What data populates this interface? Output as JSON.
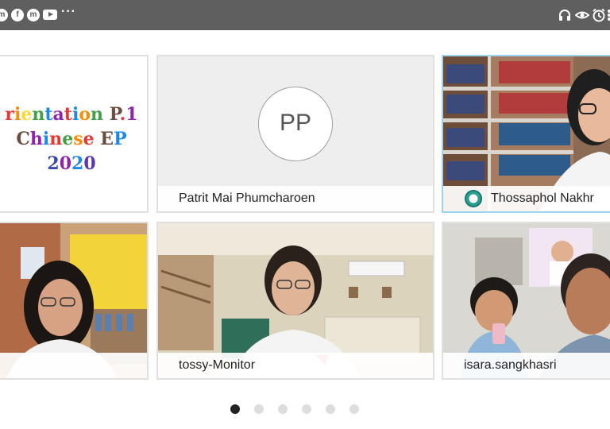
{
  "topbar": {
    "left_icons": [
      "messenger-icon",
      "facebook-icon",
      "messenger-icon",
      "youtube-icon",
      "more-icon"
    ],
    "more_label": "···",
    "right_icons": [
      "headphones-icon",
      "eye-icon",
      "alarm-icon",
      "overflow-icon"
    ]
  },
  "tiles": [
    {
      "type": "shared-content",
      "lines": [
        {
          "text": "rientation P.1",
          "colors": [
            "#e53935",
            "#fb8c00",
            "#fdd835",
            "#43a047",
            "#1e88e5",
            "#8e24aa",
            "#e53935",
            "#1e88e5",
            "#fb8c00",
            "#43a047",
            "#6d4c41",
            "#e53935",
            "#8e24aa",
            "#1e88e5"
          ]
        },
        {
          "text": "Chinese EP",
          "colors": [
            "#6d4c41",
            "#8e24aa",
            "#1e88e5",
            "#e53935",
            "#43a047",
            "#fb8c00",
            "#e53935",
            "#6d4c41",
            "#1e88e5",
            "#8e24aa"
          ]
        },
        {
          "text": "2020",
          "colors": [
            "#3949ab",
            "#8e24aa",
            "#1e88e5",
            "#5e35b1"
          ]
        }
      ]
    },
    {
      "type": "avatar",
      "initials": "PP",
      "name": "Patrit Mai Phumcharoen"
    },
    {
      "type": "video",
      "name": "Thossaphol Nakhr",
      "has_icon": true
    },
    {
      "type": "video",
      "name": ""
    },
    {
      "type": "video",
      "name": "tossy-Monitor"
    },
    {
      "type": "video",
      "name": "isara.sangkhasri"
    }
  ],
  "pager": {
    "count": 6,
    "active_index": 0
  },
  "colors": {
    "topbar": "#5f5f5f",
    "active_border": "#9ed3f0",
    "tile_bg": "#eeeeee"
  }
}
